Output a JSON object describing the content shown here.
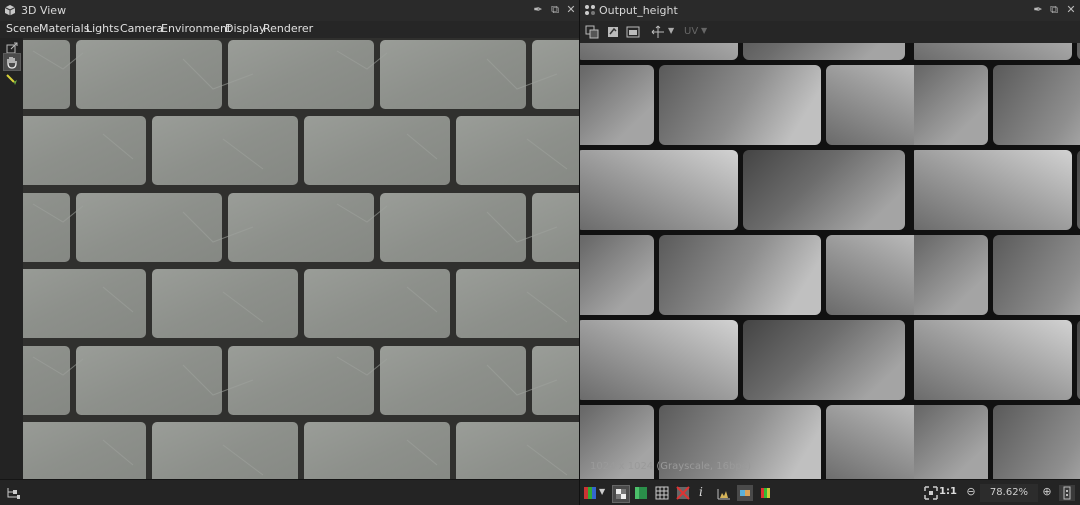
{
  "left_panel": {
    "title": "3D View",
    "menu": [
      "Scene",
      "Materials",
      "Lights",
      "Camera",
      "Environment",
      "Display",
      "Renderer"
    ]
  },
  "right_panel": {
    "title": "Output_height",
    "uv_label": "UV",
    "resolution_info": "1024 x 1024 (Grayscale, 16bpc)",
    "zoom_ratio_label": "1:1",
    "zoom_value": "78.62%"
  },
  "colors": {
    "brick_3d": "#8c8f8a",
    "mortar_3d": "#2f2f2d",
    "mortar_2d": "#111111"
  }
}
